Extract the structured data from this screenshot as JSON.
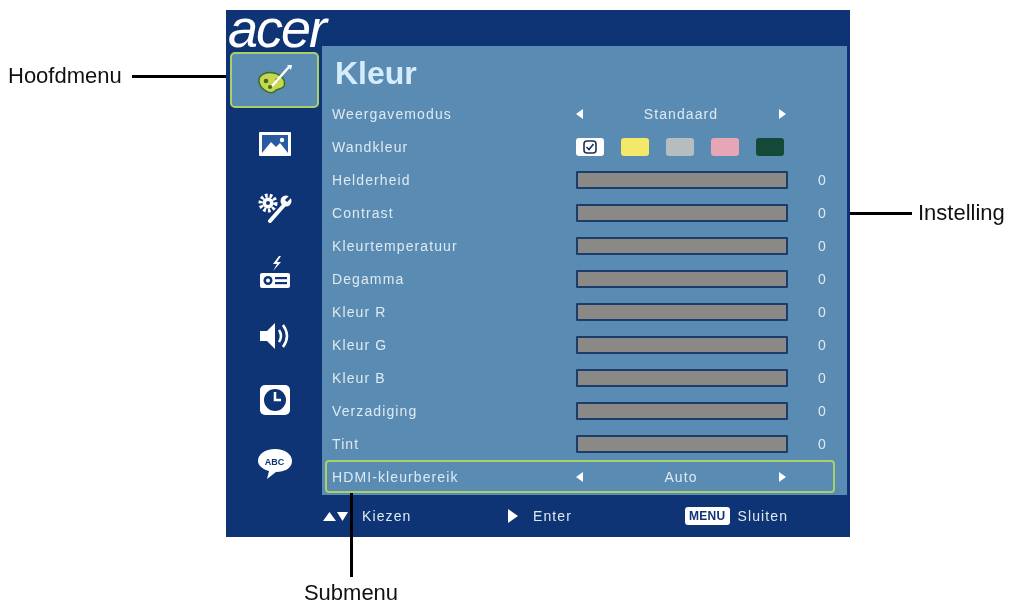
{
  "logo": "acer",
  "sidebar": {
    "items": [
      {
        "kind": "color",
        "selected": true
      },
      {
        "kind": "image",
        "selected": false
      },
      {
        "kind": "settings",
        "selected": false
      },
      {
        "kind": "management",
        "selected": false
      },
      {
        "kind": "audio",
        "selected": false
      },
      {
        "kind": "timer",
        "selected": false
      },
      {
        "kind": "language",
        "selected": false,
        "label": "ABC"
      }
    ]
  },
  "menu": {
    "title": "Kleur",
    "rows": [
      {
        "kind": "selector",
        "label": "Weergavemodus",
        "value": "Standaard",
        "selected": false
      },
      {
        "kind": "swatches",
        "label": "Wandkleur",
        "selected": false,
        "options": [
          {
            "color": "#ffffff",
            "selected": true
          },
          {
            "color": "#f3e86a",
            "selected": false
          },
          {
            "color": "#b5bdc0",
            "selected": false
          },
          {
            "color": "#e6a6b6",
            "selected": false
          },
          {
            "color": "#14493a",
            "selected": false
          }
        ]
      },
      {
        "kind": "slider",
        "label": "Helderheid",
        "reading": "0",
        "selected": false
      },
      {
        "kind": "slider",
        "label": "Contrast",
        "reading": "0",
        "selected": false
      },
      {
        "kind": "slider",
        "label": "Kleurtemperatuur",
        "reading": "0",
        "selected": false
      },
      {
        "kind": "slider",
        "label": "Degamma",
        "reading": "0",
        "selected": false
      },
      {
        "kind": "slider",
        "label": "Kleur R",
        "reading": "0",
        "selected": false
      },
      {
        "kind": "slider",
        "label": "Kleur G",
        "reading": "0",
        "selected": false
      },
      {
        "kind": "slider",
        "label": "Kleur B",
        "reading": "0",
        "selected": false
      },
      {
        "kind": "slider",
        "label": "Verzadiging",
        "reading": "0",
        "selected": false
      },
      {
        "kind": "slider",
        "label": "Tint",
        "reading": "0",
        "selected": false
      },
      {
        "kind": "selector",
        "label": "HDMI-kleurbereik",
        "value": "Auto",
        "selected": true
      }
    ]
  },
  "footer": {
    "hints": [
      {
        "kind": "up-down",
        "label": "Kiezen"
      },
      {
        "kind": "enter",
        "label": "Enter"
      },
      {
        "kind": "key",
        "key": "MENU",
        "label": "Sluiten"
      }
    ]
  },
  "callouts": {
    "main_menu": "Hoofdmenu",
    "setting": "Instelling",
    "submenu": "Submenu"
  }
}
